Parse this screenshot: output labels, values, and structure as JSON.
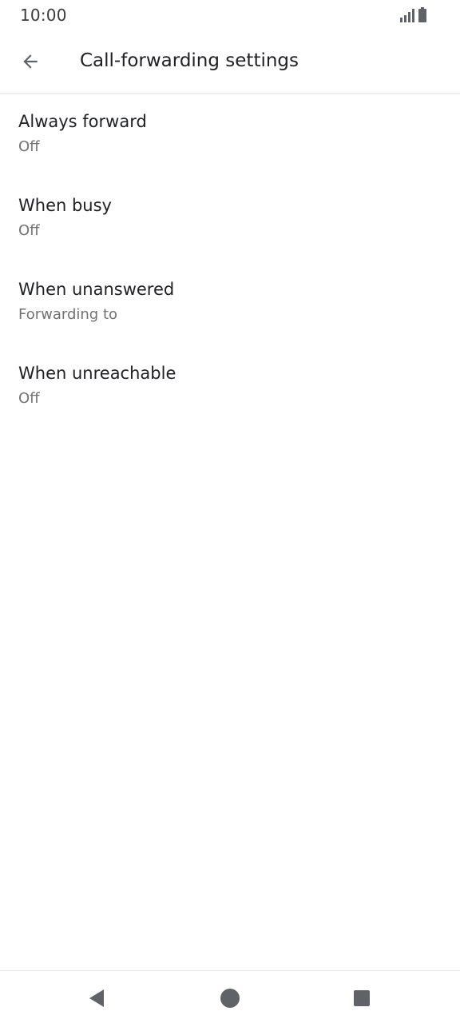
{
  "status_bar": {
    "time": "10:00",
    "icons": [
      "signal-icon",
      "battery-icon"
    ]
  },
  "app_bar": {
    "back_icon": "arrow-back-icon",
    "title": "Call-forwarding settings"
  },
  "items": [
    {
      "title": "Always forward",
      "summary": "Off"
    },
    {
      "title": "When busy",
      "summary": "Off"
    },
    {
      "title": "When unanswered",
      "summary": "Forwarding to"
    },
    {
      "title": "When unreachable",
      "summary": "Off"
    }
  ],
  "nav_bar": {
    "buttons": [
      "nav-back-icon",
      "nav-home-icon",
      "nav-recents-icon"
    ]
  },
  "colors": {
    "text_primary": "#202124",
    "text_secondary": "#727272",
    "icon": "#5f6368",
    "divider": "#e6e6e6"
  }
}
